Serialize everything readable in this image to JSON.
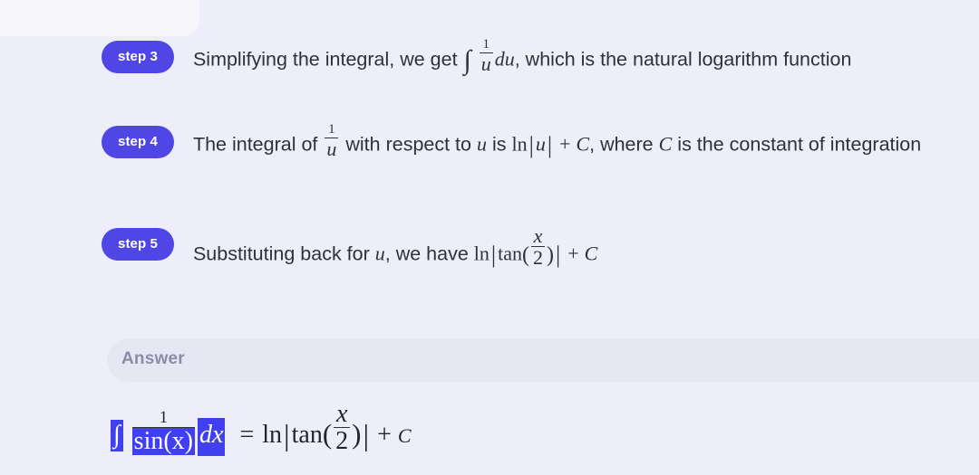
{
  "theme": {
    "page_background": "#eeeefa",
    "badge_color": "#4f46e5",
    "badge_text_color": "#ffffff",
    "answer_band_color": "#e7e7f3",
    "answer_label_color": "#8b8ca8",
    "selection_highlight_color": "#4040f0",
    "body_text_color": "#2f3136"
  },
  "steps": [
    {
      "badge": "step 3",
      "text_before_math": "Simplifying the integral, we get",
      "math": "∫ 1/u du",
      "text_after_math": ", which is the natural logarithm function",
      "math_parts": {
        "integral": "∫",
        "fraction_numerator": "1",
        "fraction_denominator": "u",
        "differential": "du"
      }
    },
    {
      "badge": "step 4",
      "text_before_math": "The integral of",
      "math": "1/u",
      "text_mid_1": "with respect to",
      "math_variable": "u",
      "text_mid_2": "is",
      "math_result": "ln |u| + C",
      "text_mid_3": ", where",
      "math_constant": "C",
      "text_after_math": "is the constant of integration",
      "math_parts": {
        "fraction_numerator": "1",
        "fraction_denominator": "u",
        "log_operator": "ln",
        "abs_var": "u",
        "plus": "+",
        "constant": "C"
      }
    },
    {
      "badge": "step 5",
      "text_before_math": "Substituting back for",
      "math_variable": "u",
      "text_mid_1": ", we have",
      "math_result": "ln | tan(x/2) | + C",
      "math_parts": {
        "log_operator": "ln",
        "tan_operator": "tan",
        "fraction_numerator": "x",
        "fraction_denominator": "2",
        "plus": "+",
        "constant": "C"
      }
    }
  ],
  "answer": {
    "label": "Answer",
    "equation_plain": "∫ 1/sin(x) dx = ln | tan(x/2) | + C",
    "lhs": {
      "integral": "∫",
      "fraction_numerator": "1",
      "fraction_denominator": "sin(x)",
      "differential": "dx",
      "selected": true
    },
    "relation": "=",
    "rhs": {
      "log_operator": "ln",
      "tan_operator": "tan",
      "fraction_numerator": "x",
      "fraction_denominator": "2",
      "plus": "+",
      "constant": "C"
    }
  }
}
